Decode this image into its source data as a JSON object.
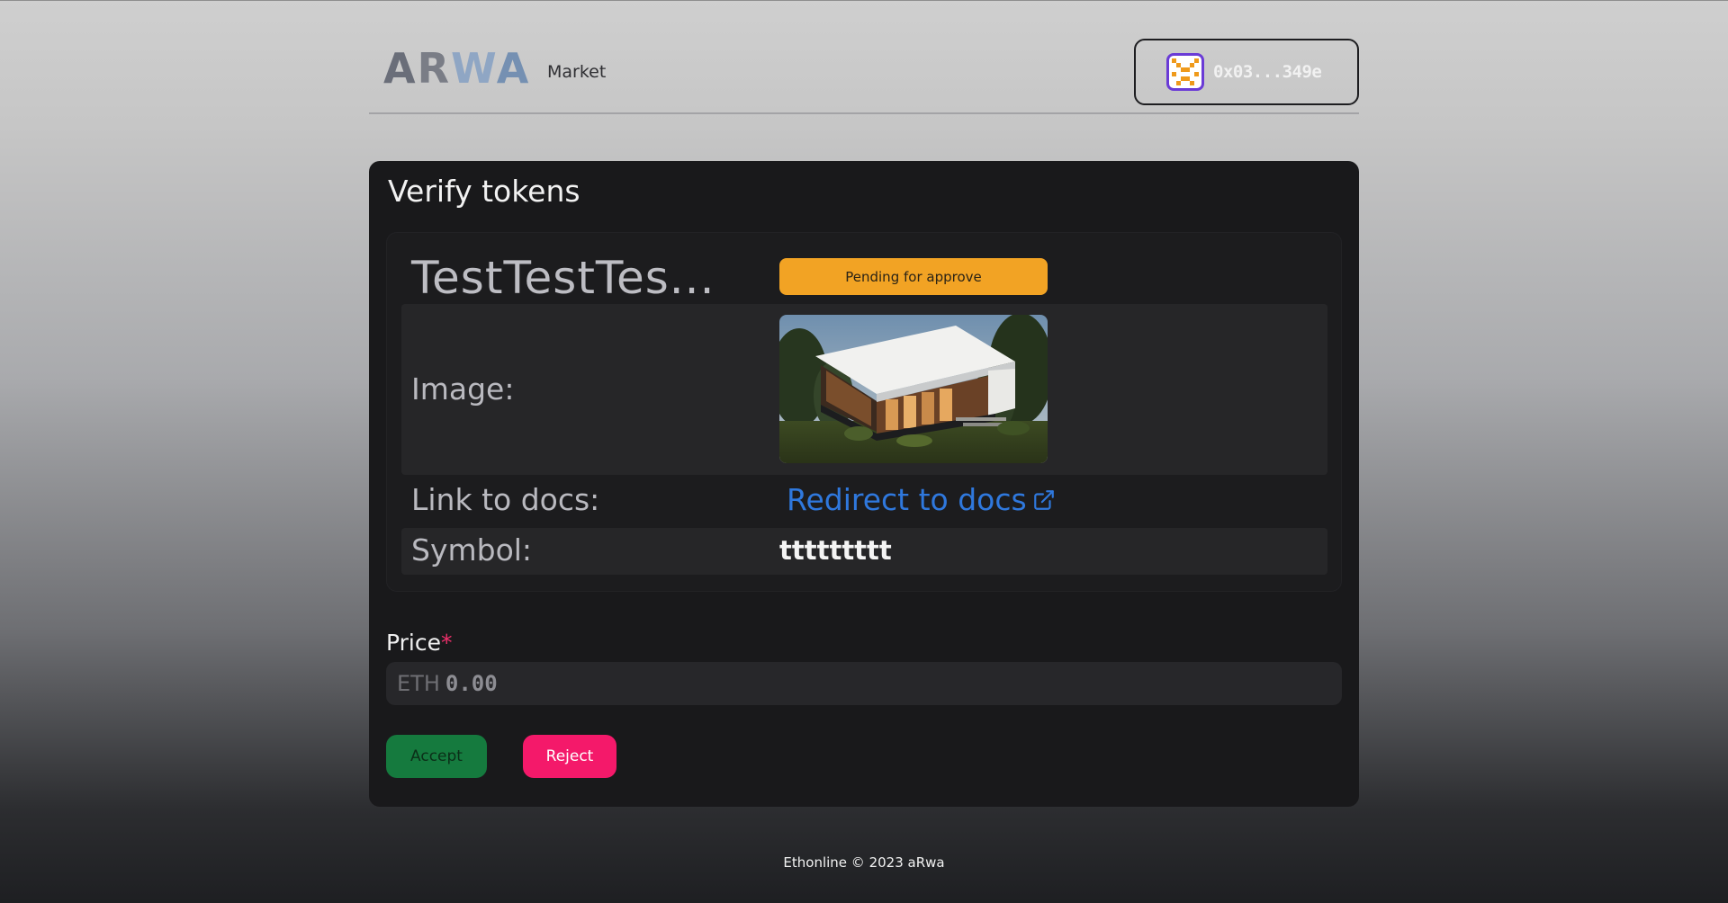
{
  "header": {
    "logo": "ARWA",
    "nav_market": "Market",
    "wallet_address": "0x03...349e"
  },
  "page": {
    "title": "Verify tokens"
  },
  "token": {
    "name": "TestTestTes...",
    "status": "Pending for approve",
    "image_label": "Image:",
    "docs_label": "Link to docs:",
    "docs_link_text": "Redirect to docs",
    "symbol_label": "Symbol:",
    "symbol_value": "ttttttttt"
  },
  "form": {
    "price_label": "Price",
    "required_mark": "*",
    "price_unit": "ETH",
    "price_placeholder": "0.00",
    "accept_label": "Accept",
    "reject_label": "Reject"
  },
  "footer": {
    "text": "Ethonline © 2023 aRwa"
  },
  "colors": {
    "status_badge": "#f2a324",
    "accept": "#157a3e",
    "reject": "#f4196a",
    "link": "#2f78dd",
    "card_bg": "#19191b"
  },
  "icons": {
    "external_link": "external-link-icon",
    "wallet_avatar": "wallet-avatar-icon"
  }
}
